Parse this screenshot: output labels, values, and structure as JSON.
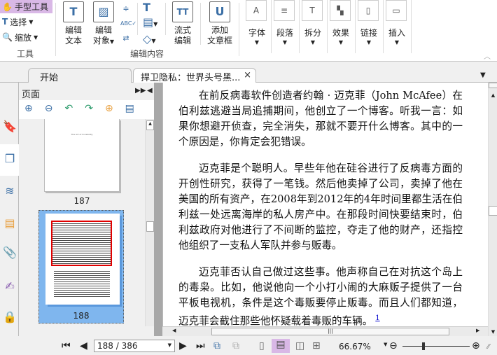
{
  "ribbon": {
    "tools": {
      "hand": "手型工具",
      "select": "选择",
      "zoom": "缩放",
      "group": "工具"
    },
    "edit": {
      "edit_text": [
        "编辑",
        "文本"
      ],
      "edit_object": [
        "编辑",
        "对象"
      ],
      "flow_edit": [
        "流式",
        "编辑"
      ],
      "add_frame": [
        "添加",
        "文章框"
      ],
      "group": "编辑内容"
    },
    "format": [
      {
        "label": "字体",
        "icon": "font-icon"
      },
      {
        "label": "段落",
        "icon": "paragraph-icon"
      },
      {
        "label": "拆分",
        "icon": "split-icon"
      },
      {
        "label": "效果",
        "icon": "effect-icon"
      },
      {
        "label": "链接",
        "icon": "link-icon"
      },
      {
        "label": "插入",
        "icon": "insert-icon"
      }
    ]
  },
  "tabs": [
    {
      "label": "开始"
    },
    {
      "label": "捍卫隐私：世界头号黑...",
      "close": "×"
    }
  ],
  "panel": {
    "title": "页面",
    "pages": [
      {
        "number": "187",
        "mini_title": "The Art of Invisibility"
      },
      {
        "number": "188"
      }
    ]
  },
  "document": {
    "paragraphs": [
      [
        "在前反病毒软件创造者约翰 · 迈克菲（John McAfee）在",
        "伯利兹逃避当局追捕期间，他创立了一个博客。听我一言：如",
        "果你想避开侦查，完全消失，那就不要开什么博客。其中的一",
        "个原因是，你肯定会犯错误。"
      ],
      [
        "迈克菲是个聪明人。早些年他在硅谷进行了反病毒方面的",
        "开创性研究，获得了一笔钱。然后他卖掉了公司，卖掉了他在",
        "美国的所有资产，在2008年到2012年的4年时间里都生活在伯",
        "利兹一处远离海岸的私人房产中。在那段时间快要结束时，伯",
        "利兹政府对他进行了不间断的监控，夺走了他的财产，还指控",
        "他组织了一支私人军队并参与贩毒。"
      ],
      [
        "迈克菲否认自己做过这些事。他声称自己在对抗这个岛上",
        "的毒枭。比如，他说他向一个小打小闹的大麻贩子提供了一台",
        "平板电视机，条件是这个毒贩要停止贩毒。而且人们都知道，",
        "迈克菲会截住那些他怀疑载着毒贩的车辆。"
      ]
    ],
    "footnote": "1"
  },
  "status": {
    "page_input": "188 / 386",
    "zoom": "66.67%"
  },
  "colors": {
    "accent": "#d9b8e6",
    "selected_thumb": "#7fb6ee",
    "highlight_box": "#e00000"
  }
}
